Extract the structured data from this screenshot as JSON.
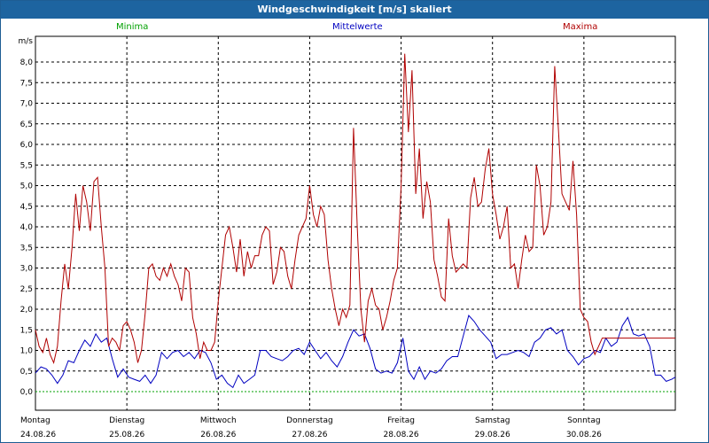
{
  "window": {
    "title": "Windgeschwindigkeit [m/s] skaliert"
  },
  "legend": [
    {
      "label": "Minima",
      "color": "#00a000"
    },
    {
      "label": "Mittelwerte",
      "color": "#0000c0"
    },
    {
      "label": "Maxima",
      "color": "#b00000"
    }
  ],
  "chart_data": {
    "type": "line",
    "title": "Windgeschwindigkeit [m/s] skaliert",
    "ylabel": "m/s",
    "ylim": [
      0,
      8.5
    ],
    "yticks": [
      "0,0",
      "0,5",
      "1,0",
      "1,5",
      "2,0",
      "2,5",
      "3,0",
      "3,5",
      "4,0",
      "4,5",
      "5,0",
      "5,5",
      "6,0",
      "6,5",
      "7,0",
      "7,5",
      "8,0"
    ],
    "xlim": [
      0,
      7
    ],
    "grid": true,
    "legend_position": "top",
    "days": [
      {
        "day": "Montag",
        "date": "24.08.26"
      },
      {
        "day": "Dienstag",
        "date": "25.08.26"
      },
      {
        "day": "Mittwoch",
        "date": "26.08.26"
      },
      {
        "day": "Donnerstag",
        "date": "27.08.26"
      },
      {
        "day": "Freitag",
        "date": "28.08.26"
      },
      {
        "day": "Samstag",
        "date": "29.08.26"
      },
      {
        "day": "Sonntag",
        "date": "30.08.26"
      }
    ],
    "series": [
      {
        "name": "Minima",
        "color": "#00a000",
        "points": [
          [
            0,
            0.0
          ],
          [
            7,
            0.0
          ]
        ]
      },
      {
        "name": "Mittelwerte",
        "color": "#0000c0",
        "points": [
          [
            0.0,
            0.45
          ],
          [
            0.06,
            0.6
          ],
          [
            0.12,
            0.55
          ],
          [
            0.18,
            0.4
          ],
          [
            0.24,
            0.2
          ],
          [
            0.3,
            0.4
          ],
          [
            0.36,
            0.75
          ],
          [
            0.42,
            0.7
          ],
          [
            0.48,
            1.0
          ],
          [
            0.54,
            1.25
          ],
          [
            0.6,
            1.1
          ],
          [
            0.66,
            1.4
          ],
          [
            0.72,
            1.2
          ],
          [
            0.78,
            1.3
          ],
          [
            0.84,
            0.8
          ],
          [
            0.9,
            0.35
          ],
          [
            0.96,
            0.55
          ],
          [
            1.02,
            0.35
          ],
          [
            1.08,
            0.3
          ],
          [
            1.14,
            0.25
          ],
          [
            1.2,
            0.4
          ],
          [
            1.26,
            0.2
          ],
          [
            1.32,
            0.4
          ],
          [
            1.38,
            0.95
          ],
          [
            1.44,
            0.8
          ],
          [
            1.5,
            0.95
          ],
          [
            1.56,
            1.0
          ],
          [
            1.62,
            0.85
          ],
          [
            1.68,
            0.95
          ],
          [
            1.74,
            0.8
          ],
          [
            1.8,
            1.0
          ],
          [
            1.86,
            0.95
          ],
          [
            1.92,
            0.7
          ],
          [
            1.98,
            0.3
          ],
          [
            2.04,
            0.4
          ],
          [
            2.1,
            0.2
          ],
          [
            2.16,
            0.1
          ],
          [
            2.22,
            0.4
          ],
          [
            2.28,
            0.2
          ],
          [
            2.34,
            0.3
          ],
          [
            2.4,
            0.4
          ],
          [
            2.46,
            1.0
          ],
          [
            2.52,
            1.0
          ],
          [
            2.58,
            0.85
          ],
          [
            2.64,
            0.8
          ],
          [
            2.7,
            0.75
          ],
          [
            2.76,
            0.85
          ],
          [
            2.82,
            1.0
          ],
          [
            2.88,
            1.05
          ],
          [
            2.94,
            0.9
          ],
          [
            3.0,
            1.2
          ],
          [
            3.06,
            1.0
          ],
          [
            3.12,
            0.8
          ],
          [
            3.18,
            0.95
          ],
          [
            3.24,
            0.75
          ],
          [
            3.3,
            0.6
          ],
          [
            3.36,
            0.85
          ],
          [
            3.42,
            1.2
          ],
          [
            3.48,
            1.5
          ],
          [
            3.54,
            1.35
          ],
          [
            3.6,
            1.4
          ],
          [
            3.66,
            1.05
          ],
          [
            3.72,
            0.55
          ],
          [
            3.78,
            0.45
          ],
          [
            3.84,
            0.5
          ],
          [
            3.9,
            0.45
          ],
          [
            3.96,
            0.7
          ],
          [
            4.02,
            1.3
          ],
          [
            4.08,
            0.5
          ],
          [
            4.14,
            0.3
          ],
          [
            4.2,
            0.6
          ],
          [
            4.26,
            0.3
          ],
          [
            4.32,
            0.5
          ],
          [
            4.38,
            0.45
          ],
          [
            4.44,
            0.55
          ],
          [
            4.5,
            0.75
          ],
          [
            4.56,
            0.85
          ],
          [
            4.62,
            0.85
          ],
          [
            4.68,
            1.35
          ],
          [
            4.74,
            1.85
          ],
          [
            4.8,
            1.7
          ],
          [
            4.86,
            1.5
          ],
          [
            4.92,
            1.35
          ],
          [
            4.98,
            1.2
          ],
          [
            5.04,
            0.8
          ],
          [
            5.1,
            0.9
          ],
          [
            5.16,
            0.9
          ],
          [
            5.22,
            0.95
          ],
          [
            5.28,
            1.0
          ],
          [
            5.34,
            0.95
          ],
          [
            5.4,
            0.85
          ],
          [
            5.46,
            1.2
          ],
          [
            5.52,
            1.3
          ],
          [
            5.58,
            1.5
          ],
          [
            5.64,
            1.55
          ],
          [
            5.7,
            1.4
          ],
          [
            5.76,
            1.5
          ],
          [
            5.82,
            1.0
          ],
          [
            5.88,
            0.85
          ],
          [
            5.94,
            0.65
          ],
          [
            6.0,
            0.8
          ],
          [
            6.06,
            0.85
          ],
          [
            6.12,
            1.0
          ],
          [
            6.18,
            0.95
          ],
          [
            6.24,
            1.3
          ],
          [
            6.3,
            1.1
          ],
          [
            6.36,
            1.2
          ],
          [
            6.42,
            1.6
          ],
          [
            6.48,
            1.8
          ],
          [
            6.54,
            1.4
          ],
          [
            6.6,
            1.35
          ],
          [
            6.66,
            1.4
          ],
          [
            6.72,
            1.1
          ],
          [
            6.78,
            0.4
          ],
          [
            6.84,
            0.4
          ],
          [
            6.9,
            0.25
          ],
          [
            6.96,
            0.3
          ],
          [
            7.0,
            0.35
          ]
        ]
      },
      {
        "name": "Maxima",
        "color": "#b00000",
        "points": [
          [
            0.0,
            1.5
          ],
          [
            0.04,
            1.1
          ],
          [
            0.08,
            0.95
          ],
          [
            0.12,
            1.3
          ],
          [
            0.16,
            0.9
          ],
          [
            0.2,
            0.7
          ],
          [
            0.24,
            1.1
          ],
          [
            0.28,
            2.2
          ],
          [
            0.32,
            3.1
          ],
          [
            0.36,
            2.5
          ],
          [
            0.4,
            3.5
          ],
          [
            0.44,
            4.8
          ],
          [
            0.48,
            3.9
          ],
          [
            0.52,
            5.0
          ],
          [
            0.56,
            4.6
          ],
          [
            0.6,
            3.9
          ],
          [
            0.64,
            5.1
          ],
          [
            0.68,
            5.2
          ],
          [
            0.72,
            4.0
          ],
          [
            0.76,
            3.0
          ],
          [
            0.8,
            1.1
          ],
          [
            0.84,
            1.3
          ],
          [
            0.88,
            1.2
          ],
          [
            0.92,
            1.0
          ],
          [
            0.96,
            1.6
          ],
          [
            1.0,
            1.7
          ],
          [
            1.04,
            1.5
          ],
          [
            1.08,
            1.2
          ],
          [
            1.12,
            0.7
          ],
          [
            1.16,
            1.0
          ],
          [
            1.2,
            1.9
          ],
          [
            1.24,
            3.0
          ],
          [
            1.28,
            3.1
          ],
          [
            1.32,
            2.8
          ],
          [
            1.36,
            2.7
          ],
          [
            1.4,
            3.0
          ],
          [
            1.44,
            2.8
          ],
          [
            1.48,
            3.1
          ],
          [
            1.52,
            2.8
          ],
          [
            1.56,
            2.6
          ],
          [
            1.6,
            2.2
          ],
          [
            1.64,
            3.0
          ],
          [
            1.68,
            2.9
          ],
          [
            1.72,
            1.8
          ],
          [
            1.76,
            1.4
          ],
          [
            1.8,
            0.8
          ],
          [
            1.84,
            1.2
          ],
          [
            1.88,
            1.0
          ],
          [
            1.92,
            1.0
          ],
          [
            1.96,
            1.2
          ],
          [
            2.0,
            2.2
          ],
          [
            2.04,
            3.0
          ],
          [
            2.08,
            3.8
          ],
          [
            2.12,
            4.0
          ],
          [
            2.16,
            3.5
          ],
          [
            2.2,
            2.9
          ],
          [
            2.24,
            3.7
          ],
          [
            2.28,
            2.8
          ],
          [
            2.32,
            3.4
          ],
          [
            2.36,
            3.0
          ],
          [
            2.4,
            3.3
          ],
          [
            2.44,
            3.3
          ],
          [
            2.48,
            3.8
          ],
          [
            2.52,
            4.0
          ],
          [
            2.56,
            3.9
          ],
          [
            2.6,
            2.6
          ],
          [
            2.64,
            2.9
          ],
          [
            2.68,
            3.5
          ],
          [
            2.72,
            3.4
          ],
          [
            2.76,
            2.8
          ],
          [
            2.8,
            2.5
          ],
          [
            2.84,
            3.2
          ],
          [
            2.88,
            3.8
          ],
          [
            2.92,
            4.0
          ],
          [
            2.96,
            4.2
          ],
          [
            3.0,
            5.0
          ],
          [
            3.04,
            4.3
          ],
          [
            3.08,
            4.0
          ],
          [
            3.12,
            4.5
          ],
          [
            3.16,
            4.3
          ],
          [
            3.2,
            3.2
          ],
          [
            3.24,
            2.5
          ],
          [
            3.28,
            2.0
          ],
          [
            3.32,
            1.6
          ],
          [
            3.36,
            2.0
          ],
          [
            3.4,
            1.8
          ],
          [
            3.44,
            2.1
          ],
          [
            3.48,
            6.4
          ],
          [
            3.52,
            4.0
          ],
          [
            3.56,
            2.0
          ],
          [
            3.6,
            1.2
          ],
          [
            3.64,
            2.2
          ],
          [
            3.68,
            2.5
          ],
          [
            3.72,
            2.1
          ],
          [
            3.76,
            2.0
          ],
          [
            3.8,
            1.5
          ],
          [
            3.84,
            1.8
          ],
          [
            3.88,
            2.2
          ],
          [
            3.92,
            2.7
          ],
          [
            3.96,
            3.0
          ],
          [
            4.0,
            5.0
          ],
          [
            4.04,
            8.2
          ],
          [
            4.08,
            6.3
          ],
          [
            4.12,
            7.8
          ],
          [
            4.16,
            4.8
          ],
          [
            4.2,
            5.9
          ],
          [
            4.24,
            4.2
          ],
          [
            4.28,
            5.1
          ],
          [
            4.32,
            4.6
          ],
          [
            4.36,
            3.2
          ],
          [
            4.4,
            2.8
          ],
          [
            4.44,
            2.3
          ],
          [
            4.48,
            2.2
          ],
          [
            4.52,
            4.2
          ],
          [
            4.56,
            3.3
          ],
          [
            4.6,
            2.9
          ],
          [
            4.64,
            3.0
          ],
          [
            4.68,
            3.1
          ],
          [
            4.72,
            3.0
          ],
          [
            4.76,
            4.7
          ],
          [
            4.8,
            5.2
          ],
          [
            4.84,
            4.5
          ],
          [
            4.88,
            4.6
          ],
          [
            4.92,
            5.4
          ],
          [
            4.96,
            5.9
          ],
          [
            5.0,
            4.8
          ],
          [
            5.04,
            4.3
          ],
          [
            5.08,
            3.7
          ],
          [
            5.12,
            4.0
          ],
          [
            5.16,
            4.5
          ],
          [
            5.2,
            3.0
          ],
          [
            5.24,
            3.1
          ],
          [
            5.28,
            2.5
          ],
          [
            5.32,
            3.2
          ],
          [
            5.36,
            3.8
          ],
          [
            5.4,
            3.4
          ],
          [
            5.44,
            3.5
          ],
          [
            5.48,
            5.5
          ],
          [
            5.52,
            5.0
          ],
          [
            5.56,
            3.8
          ],
          [
            5.6,
            4.0
          ],
          [
            5.64,
            4.6
          ],
          [
            5.68,
            7.9
          ],
          [
            5.72,
            6.4
          ],
          [
            5.76,
            4.8
          ],
          [
            5.8,
            4.6
          ],
          [
            5.84,
            4.4
          ],
          [
            5.88,
            5.6
          ],
          [
            5.92,
            4.3
          ],
          [
            5.96,
            2.0
          ],
          [
            6.0,
            1.8
          ],
          [
            6.04,
            1.7
          ],
          [
            6.08,
            1.2
          ],
          [
            6.12,
            0.9
          ],
          [
            6.16,
            1.1
          ],
          [
            6.2,
            1.3
          ],
          [
            6.9,
            1.3
          ],
          [
            7.0,
            1.3
          ]
        ]
      }
    ]
  }
}
